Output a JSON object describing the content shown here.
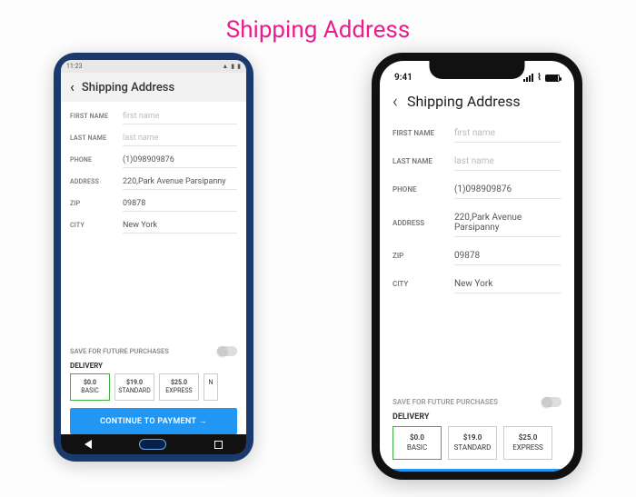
{
  "page_title": "Shipping Address",
  "android": {
    "status_time": "11:23",
    "header_title": "Shipping Address",
    "fields": {
      "first_name": {
        "label": "FIRST NAME",
        "value": "first name",
        "is_placeholder": true
      },
      "last_name": {
        "label": "LAST NAME",
        "value": "last name",
        "is_placeholder": true
      },
      "phone": {
        "label": "PHONE",
        "value": "(1)098909876"
      },
      "address": {
        "label": "ADDRESS",
        "value": "220,Park Avenue Parsipanny"
      },
      "zip": {
        "label": "ZIP",
        "value": "09878"
      },
      "city": {
        "label": "CITY",
        "value": "New York"
      }
    },
    "save_label": "SAVE FOR FUTURE PURCHASES",
    "save_on": false,
    "delivery_label": "DELIVERY",
    "delivery_options": [
      {
        "price": "$0.0",
        "name": "BASIC",
        "selected": true
      },
      {
        "price": "$19.0",
        "name": "STANDARD",
        "selected": false
      },
      {
        "price": "$25.0",
        "name": "EXPRESS",
        "selected": false
      },
      {
        "price": "",
        "name": "N",
        "selected": false
      }
    ],
    "continue_label": "CONTINUE TO PAYMENT →"
  },
  "ios": {
    "status_time": "9:41",
    "header_title": "Shipping Address",
    "fields": {
      "first_name": {
        "label": "FIRST NAME",
        "value": "first name",
        "is_placeholder": true
      },
      "last_name": {
        "label": "LAST NAME",
        "value": "last name",
        "is_placeholder": true
      },
      "phone": {
        "label": "PHONE",
        "value": "(1)098909876"
      },
      "address": {
        "label": "ADDRESS",
        "value": "220,Park Avenue Parsipanny"
      },
      "zip": {
        "label": "ZIP",
        "value": "09878"
      },
      "city": {
        "label": "CITY",
        "value": "New York"
      }
    },
    "save_label": "SAVE FOR FUTURE PURCHASES",
    "save_on": false,
    "delivery_label": "DELIVERY",
    "delivery_options": [
      {
        "price": "$0.0",
        "name": "BASIC",
        "selected": true
      },
      {
        "price": "$19.0",
        "name": "STANDARD",
        "selected": false
      },
      {
        "price": "$25.0",
        "name": "EXPRESS",
        "selected": false
      }
    ]
  }
}
